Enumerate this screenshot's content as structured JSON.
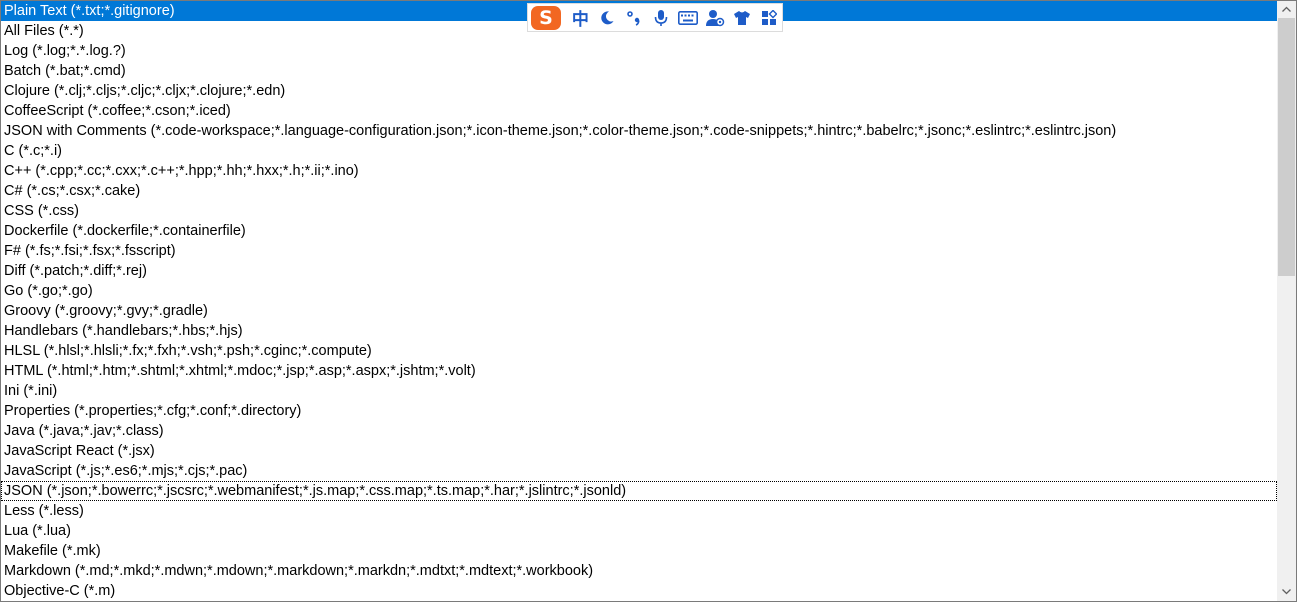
{
  "file_types": [
    "Plain Text (*.txt;*.gitignore)",
    "All Files (*.*)",
    "Log (*.log;*.*.log.?)",
    "Batch (*.bat;*.cmd)",
    "Clojure (*.clj;*.cljs;*.cljc;*.cljx;*.clojure;*.edn)",
    "CoffeeScript (*.coffee;*.cson;*.iced)",
    "JSON with Comments (*.code-workspace;*.language-configuration.json;*.icon-theme.json;*.color-theme.json;*.code-snippets;*.hintrc;*.babelrc;*.jsonc;*.eslintrc;*.eslintrc.json)",
    "C (*.c;*.i)",
    "C++ (*.cpp;*.cc;*.cxx;*.c++;*.hpp;*.hh;*.hxx;*.h;*.ii;*.ino)",
    "C# (*.cs;*.csx;*.cake)",
    "CSS (*.css)",
    "Dockerfile (*.dockerfile;*.containerfile)",
    "F# (*.fs;*.fsi;*.fsx;*.fsscript)",
    "Diff (*.patch;*.diff;*.rej)",
    "Go (*.go;*.go)",
    "Groovy (*.groovy;*.gvy;*.gradle)",
    "Handlebars (*.handlebars;*.hbs;*.hjs)",
    "HLSL (*.hlsl;*.hlsli;*.fx;*.fxh;*.vsh;*.psh;*.cginc;*.compute)",
    "HTML (*.html;*.htm;*.shtml;*.xhtml;*.mdoc;*.jsp;*.asp;*.aspx;*.jshtm;*.volt)",
    "Ini (*.ini)",
    "Properties (*.properties;*.cfg;*.conf;*.directory)",
    "Java (*.java;*.jav;*.class)",
    "JavaScript React (*.jsx)",
    "JavaScript (*.js;*.es6;*.mjs;*.cjs;*.pac)",
    "JSON (*.json;*.bowerrc;*.jscsrc;*.webmanifest;*.js.map;*.css.map;*.ts.map;*.har;*.jslintrc;*.jsonld)",
    "Less (*.less)",
    "Lua (*.lua)",
    "Makefile (*.mk)",
    "Markdown (*.md;*.mkd;*.mdwn;*.mdown;*.markdown;*.markdn;*.mdtxt;*.mdtext;*.workbook)",
    "Objective-C (*.m)"
  ],
  "selected_index": 0,
  "focused_index": 24,
  "scroll_fraction": 0.0,
  "colors": {
    "selection": "#0078d7",
    "ime_logo": "#f26722",
    "ime_icons": "#1e5cc8"
  },
  "ime_toolbar": {
    "logo_text": "S",
    "mode_text": "中",
    "icons": [
      "moon-icon",
      "punctuation-icon",
      "microphone-icon",
      "keyboard-icon",
      "user-settings-icon",
      "shirt-icon",
      "grid-apps-icon"
    ]
  }
}
